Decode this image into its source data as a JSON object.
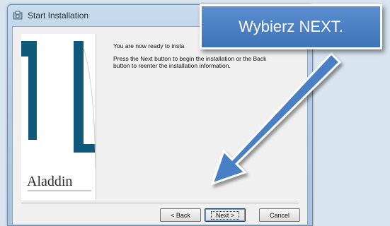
{
  "window": {
    "title": "Start Installation",
    "message_line1": "You are now ready to insta",
    "message_line2": "Press the Next button to begin the installation or the Back",
    "message_line3": "button to reenter the installation information."
  },
  "banner": {
    "logo": "Aladdin"
  },
  "buttons": {
    "back": "< Back",
    "next": "Next >",
    "cancel": "Cancel"
  },
  "callout": {
    "text": "Wybierz NEXT."
  },
  "colors": {
    "banner_bar": "#0f5a7a",
    "callout_fill": "#4a7fc4",
    "arrow": "#4a7fc4"
  }
}
